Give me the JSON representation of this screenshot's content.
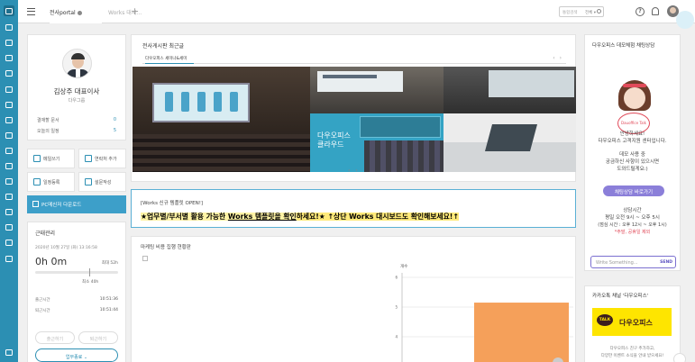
{
  "tabs": [
    {
      "label": "전사portal"
    },
    {
      "label": "Works 대시…"
    }
  ],
  "header": {
    "search_placeholder": "통합검색",
    "search_scope": "전체 ▾",
    "help_icon": "?"
  },
  "profile": {
    "name": "김상주 대표이사",
    "org": "다우그룹",
    "rows": [
      {
        "label": "결재할 문서",
        "count": "0"
      },
      {
        "label": "오늘의 일정",
        "count": "5"
      }
    ]
  },
  "quick_menu": {
    "items": [
      {
        "label": "메일쓰기"
      },
      {
        "label": "연락처 추가"
      },
      {
        "label": "일정등록"
      },
      {
        "label": "설문작성"
      }
    ],
    "pc_download": "PC메신저 다운로드"
  },
  "attendance": {
    "title": "근태관리",
    "date": "2020년 10월 27일 (화) 13:16:58",
    "worked": "0h 0m",
    "max": "최대 52h",
    "min": "최소 40h",
    "rows": [
      {
        "label": "출근시간",
        "time": "10:51:36"
      },
      {
        "label": "퇴근시간",
        "time": "10:51:44"
      }
    ],
    "btn_in": "출근하기",
    "btn_out": "퇴근하기",
    "btn_end": "업무종료 ⌄"
  },
  "gallery": {
    "title": "전사게시판 최근글",
    "tab": "다우오피스 세미나&세미",
    "photo_caption": "다우오피스\n클라우드"
  },
  "notice": {
    "head": "[Works 신규 템플릿 OPEN!]",
    "part1": "★업무별/부서별 활용 가능한 ",
    "part2": "Works 템플릿을 확인",
    "part3": "하세요!★ ↑상단 Works 대시보드도 확인해보세요!↑"
  },
  "chart_data": {
    "type": "bar",
    "title": "마케팅 비용 집행 현황판",
    "ylabel": "개수",
    "categories": [
      ""
    ],
    "values": [
      5.15
    ],
    "ylim": [
      3,
      6
    ],
    "yticks": [
      "6",
      "5",
      "4",
      "3"
    ],
    "bar_color": "#f5a05a"
  },
  "consult": {
    "title": "다우오피스 데모체험 채팅상담",
    "sign_text": "Dauoffice Talk",
    "greet1": "안녕하세요!",
    "greet2": "다우오피스 고객지원 센터입니다.",
    "desc1": "데모 사용 중",
    "desc2": "궁금하신 사항이 있으시면",
    "desc3": "도와드릴게요:)",
    "button": "채팅상담 바로가기",
    "hours_title": "상담시간",
    "hours1": "평일 오전 9시 ~ 오후 5시",
    "hours2": "(점심 시간 : 오후 12시 ~ 오후 1시)",
    "holiday": "*주말, 공휴일 제외",
    "chat_placeholder": "Write Something...",
    "send": "SEND"
  },
  "kakao": {
    "title": "카카오톡 채널 '다우오피스'",
    "talk": "TALK",
    "name": "다우오피스",
    "desc1": "다우오피스 친구 추가하고,",
    "desc2": "다양한 이벤트 소식을 안내 받으세요!"
  },
  "colors": {
    "accent": "#2c8fb3",
    "sidebar": "#2c8fb3",
    "kakao": "#fee500",
    "chat_button": "#8b7fd9"
  },
  "icons": [
    "home-icon",
    "check-icon",
    "person-icon",
    "grid-icon",
    "list-icon",
    "calendar-icon",
    "chat-icon",
    "doc-icon",
    "archive-icon",
    "clock-icon",
    "folder-icon",
    "bag-icon",
    "building-icon",
    "table-icon",
    "link-icon",
    "link2-icon",
    "org-icon"
  ]
}
